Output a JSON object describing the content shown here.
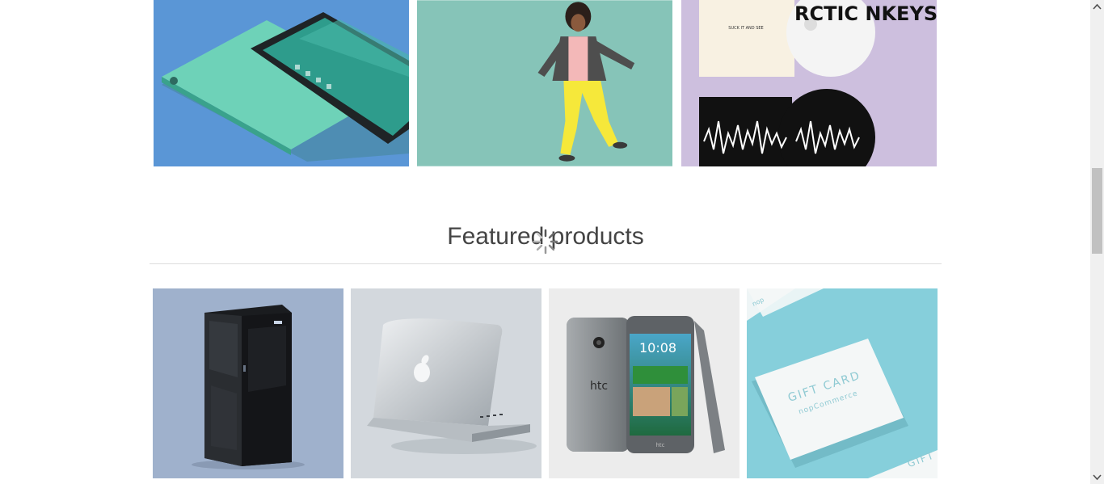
{
  "featured": {
    "title": "Featured products"
  },
  "category_tiles": [
    {
      "name": "cell-phones",
      "image": "teal-smartphone"
    },
    {
      "name": "apparel",
      "image": "woman-jumping"
    },
    {
      "name": "digital-downloads",
      "image": "album-cover"
    }
  ],
  "products": [
    {
      "image": "server-tower"
    },
    {
      "image": "laptop"
    },
    {
      "image": "htc-smartphone"
    },
    {
      "image": "gift-card"
    }
  ],
  "gift_card": {
    "line1": "GIFT CARD",
    "line2": "nopCommerce",
    "line3": "GIFT",
    "line4": "nop"
  },
  "htc": {
    "clock": "10:08",
    "brand": "htc"
  },
  "album": {
    "band": "RCTIC NKEYS",
    "small_text": "SUCK IT AND SEE"
  },
  "colors": {
    "phone_bg": "#5a96d6",
    "apparel_bg": "#86c4b8",
    "music_bg": "#cdbfde",
    "server_bg": "#9fb1cc",
    "laptop_bg": "#d3d8dd",
    "htc_bg": "#ececec",
    "giftcard_bg": "#86cfdb",
    "title_text": "#444444"
  }
}
